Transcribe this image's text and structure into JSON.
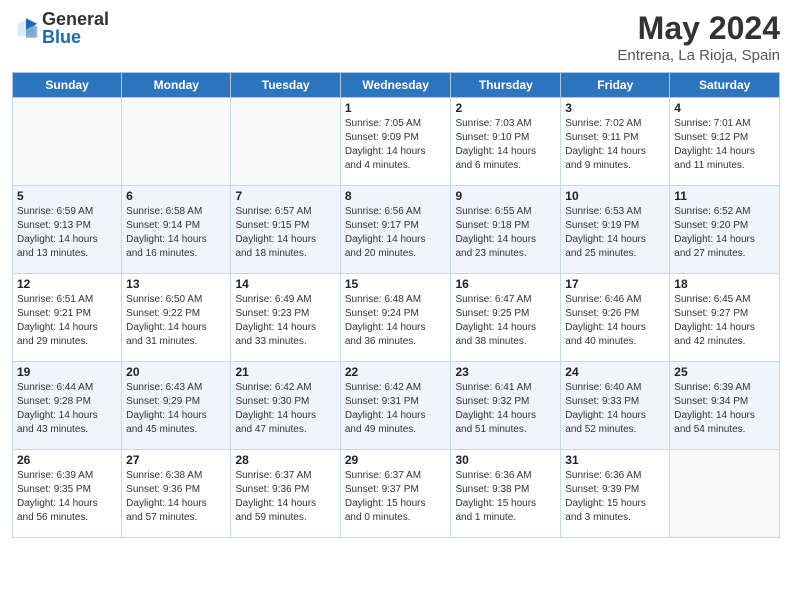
{
  "header": {
    "logo_general": "General",
    "logo_blue": "Blue",
    "title": "May 2024",
    "subtitle": "Entrena, La Rioja, Spain"
  },
  "calendar": {
    "days_of_week": [
      "Sunday",
      "Monday",
      "Tuesday",
      "Wednesday",
      "Thursday",
      "Friday",
      "Saturday"
    ],
    "weeks": [
      [
        {
          "num": "",
          "info": ""
        },
        {
          "num": "",
          "info": ""
        },
        {
          "num": "",
          "info": ""
        },
        {
          "num": "1",
          "info": "Sunrise: 7:05 AM\nSunset: 9:09 PM\nDaylight: 14 hours\nand 4 minutes."
        },
        {
          "num": "2",
          "info": "Sunrise: 7:03 AM\nSunset: 9:10 PM\nDaylight: 14 hours\nand 6 minutes."
        },
        {
          "num": "3",
          "info": "Sunrise: 7:02 AM\nSunset: 9:11 PM\nDaylight: 14 hours\nand 9 minutes."
        },
        {
          "num": "4",
          "info": "Sunrise: 7:01 AM\nSunset: 9:12 PM\nDaylight: 14 hours\nand 11 minutes."
        }
      ],
      [
        {
          "num": "5",
          "info": "Sunrise: 6:59 AM\nSunset: 9:13 PM\nDaylight: 14 hours\nand 13 minutes."
        },
        {
          "num": "6",
          "info": "Sunrise: 6:58 AM\nSunset: 9:14 PM\nDaylight: 14 hours\nand 16 minutes."
        },
        {
          "num": "7",
          "info": "Sunrise: 6:57 AM\nSunset: 9:15 PM\nDaylight: 14 hours\nand 18 minutes."
        },
        {
          "num": "8",
          "info": "Sunrise: 6:56 AM\nSunset: 9:17 PM\nDaylight: 14 hours\nand 20 minutes."
        },
        {
          "num": "9",
          "info": "Sunrise: 6:55 AM\nSunset: 9:18 PM\nDaylight: 14 hours\nand 23 minutes."
        },
        {
          "num": "10",
          "info": "Sunrise: 6:53 AM\nSunset: 9:19 PM\nDaylight: 14 hours\nand 25 minutes."
        },
        {
          "num": "11",
          "info": "Sunrise: 6:52 AM\nSunset: 9:20 PM\nDaylight: 14 hours\nand 27 minutes."
        }
      ],
      [
        {
          "num": "12",
          "info": "Sunrise: 6:51 AM\nSunset: 9:21 PM\nDaylight: 14 hours\nand 29 minutes."
        },
        {
          "num": "13",
          "info": "Sunrise: 6:50 AM\nSunset: 9:22 PM\nDaylight: 14 hours\nand 31 minutes."
        },
        {
          "num": "14",
          "info": "Sunrise: 6:49 AM\nSunset: 9:23 PM\nDaylight: 14 hours\nand 33 minutes."
        },
        {
          "num": "15",
          "info": "Sunrise: 6:48 AM\nSunset: 9:24 PM\nDaylight: 14 hours\nand 36 minutes."
        },
        {
          "num": "16",
          "info": "Sunrise: 6:47 AM\nSunset: 9:25 PM\nDaylight: 14 hours\nand 38 minutes."
        },
        {
          "num": "17",
          "info": "Sunrise: 6:46 AM\nSunset: 9:26 PM\nDaylight: 14 hours\nand 40 minutes."
        },
        {
          "num": "18",
          "info": "Sunrise: 6:45 AM\nSunset: 9:27 PM\nDaylight: 14 hours\nand 42 minutes."
        }
      ],
      [
        {
          "num": "19",
          "info": "Sunrise: 6:44 AM\nSunset: 9:28 PM\nDaylight: 14 hours\nand 43 minutes."
        },
        {
          "num": "20",
          "info": "Sunrise: 6:43 AM\nSunset: 9:29 PM\nDaylight: 14 hours\nand 45 minutes."
        },
        {
          "num": "21",
          "info": "Sunrise: 6:42 AM\nSunset: 9:30 PM\nDaylight: 14 hours\nand 47 minutes."
        },
        {
          "num": "22",
          "info": "Sunrise: 6:42 AM\nSunset: 9:31 PM\nDaylight: 14 hours\nand 49 minutes."
        },
        {
          "num": "23",
          "info": "Sunrise: 6:41 AM\nSunset: 9:32 PM\nDaylight: 14 hours\nand 51 minutes."
        },
        {
          "num": "24",
          "info": "Sunrise: 6:40 AM\nSunset: 9:33 PM\nDaylight: 14 hours\nand 52 minutes."
        },
        {
          "num": "25",
          "info": "Sunrise: 6:39 AM\nSunset: 9:34 PM\nDaylight: 14 hours\nand 54 minutes."
        }
      ],
      [
        {
          "num": "26",
          "info": "Sunrise: 6:39 AM\nSunset: 9:35 PM\nDaylight: 14 hours\nand 56 minutes."
        },
        {
          "num": "27",
          "info": "Sunrise: 6:38 AM\nSunset: 9:36 PM\nDaylight: 14 hours\nand 57 minutes."
        },
        {
          "num": "28",
          "info": "Sunrise: 6:37 AM\nSunset: 9:36 PM\nDaylight: 14 hours\nand 59 minutes."
        },
        {
          "num": "29",
          "info": "Sunrise: 6:37 AM\nSunset: 9:37 PM\nDaylight: 15 hours\nand 0 minutes."
        },
        {
          "num": "30",
          "info": "Sunrise: 6:36 AM\nSunset: 9:38 PM\nDaylight: 15 hours\nand 1 minute."
        },
        {
          "num": "31",
          "info": "Sunrise: 6:36 AM\nSunset: 9:39 PM\nDaylight: 15 hours\nand 3 minutes."
        },
        {
          "num": "",
          "info": ""
        }
      ]
    ]
  }
}
